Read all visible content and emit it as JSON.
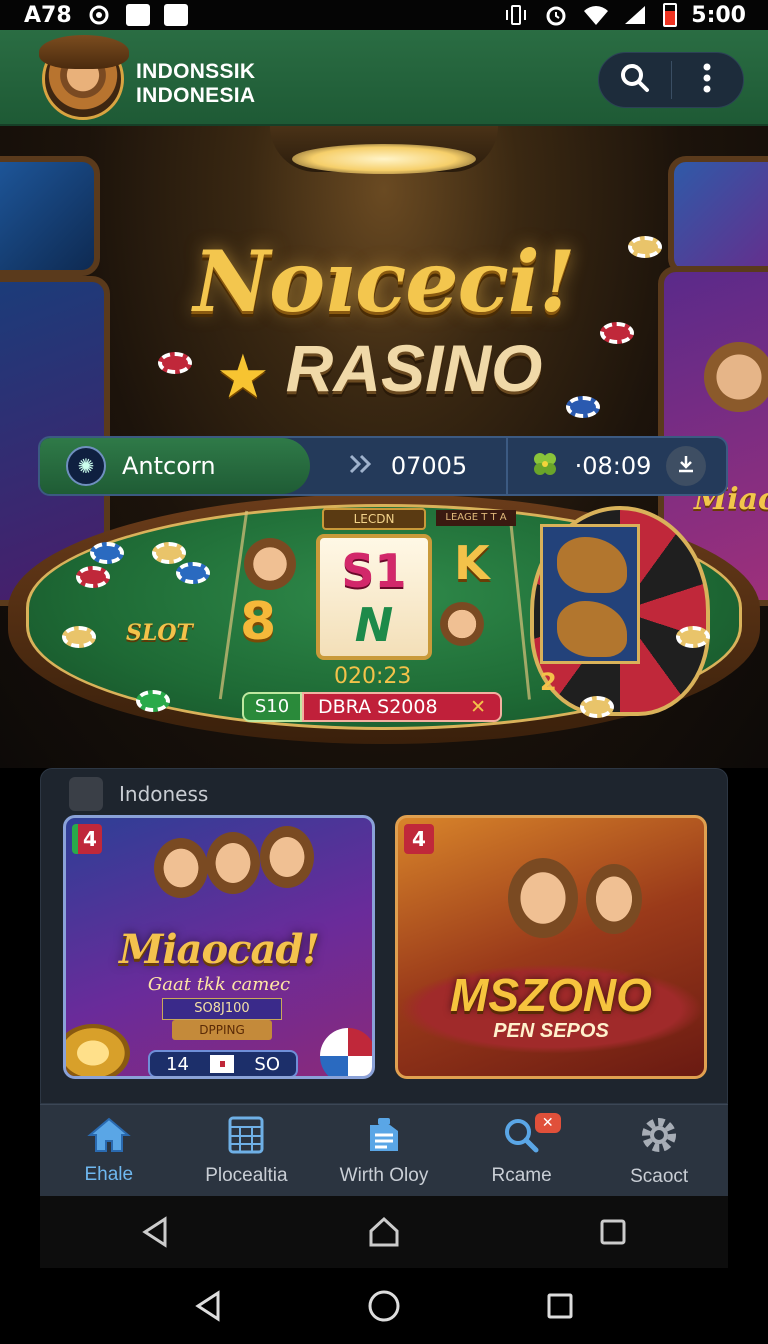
{
  "status_bar": {
    "carrier": "A78",
    "time": "5:00",
    "icons": [
      "settings-gear-icon",
      "check-box-icon",
      "b-box-icon",
      "vibrate-icon",
      "alarm-icon",
      "wifi-icon",
      "signal-icon",
      "battery-icon"
    ]
  },
  "header": {
    "brand_line1": "INDONSSIK",
    "brand_line2": "INDONESIA",
    "actions": [
      "search-icon",
      "more-vert-icon"
    ]
  },
  "hero": {
    "title_line1": "Noıceci!",
    "title_line2": "RASINO",
    "info": {
      "username": "Antcorn",
      "code": "07005",
      "timer": "·08:09"
    },
    "table": {
      "reel_label": "LECDN",
      "side_label": "LEAGE T T A",
      "slot_label": "SLOT",
      "big_number": "8",
      "reel_top": "S1",
      "reel_bottom": "N",
      "card_letter": "K",
      "counter": "020:23",
      "bet_pill_left": "S10",
      "bet_pill_right": "DBRA S2008",
      "bet_pill_close": "✕",
      "roulette_num": "2"
    }
  },
  "games": {
    "section_title": "Indoness",
    "cards": [
      {
        "badge": "4",
        "title": "Miaocad!",
        "subtitle": "Gaat tkk camec",
        "plate": "SO8J100",
        "ribbon": "DPPING",
        "score_left": "14",
        "score_right": "SO"
      },
      {
        "badge": "4",
        "title": "MSZONO",
        "subtitle": "PEN SEPOS"
      }
    ]
  },
  "bottom_nav": {
    "items": [
      {
        "label": "Ehale",
        "icon": "home-icon",
        "active": true
      },
      {
        "label": "Plocealtia",
        "icon": "calendar-grid-icon",
        "active": false
      },
      {
        "label": "Wirth Oloy",
        "icon": "document-list-icon",
        "active": false
      },
      {
        "label": "Rcame",
        "icon": "search-icon",
        "active": false,
        "badge": "✕"
      },
      {
        "label": "Scaoct",
        "icon": "gear-icon",
        "active": false
      }
    ]
  },
  "system_nav": [
    "back-icon",
    "home-icon",
    "recents-icon"
  ],
  "colors": {
    "header_green": "#2a6d43",
    "gold": "#f3c64e",
    "nav_active": "#6fb8f0",
    "panel_bg": "#1e252e"
  }
}
